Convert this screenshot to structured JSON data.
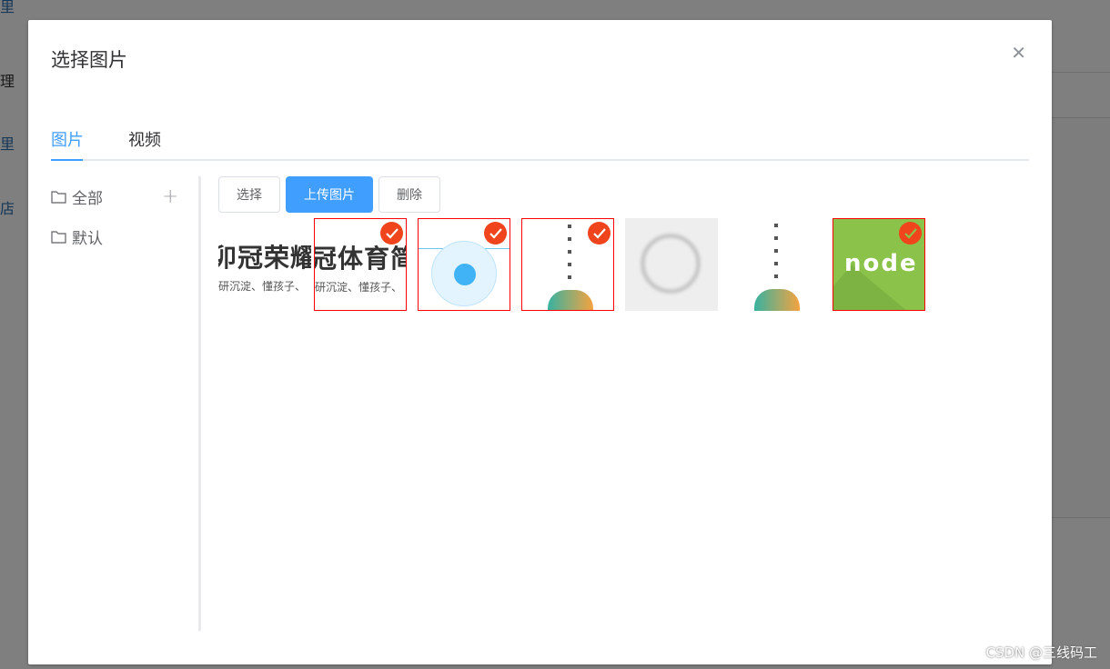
{
  "background": {
    "fragments": [
      "理",
      "理",
      "里",
      "店"
    ]
  },
  "dialog": {
    "title": "选择图片",
    "close_icon": "close-icon",
    "tabs": [
      {
        "label": "图片",
        "active": true
      },
      {
        "label": "视频",
        "active": false
      }
    ],
    "folders": [
      {
        "label": "全部",
        "icon": "folder-icon"
      },
      {
        "label": "默认",
        "icon": "folder-icon"
      }
    ],
    "add_folder_icon": "plus-icon",
    "toolbar": {
      "select": "选择",
      "upload": "上传图片",
      "delete": "删除"
    },
    "thumbnails": [
      {
        "kind": "text-image",
        "selected": false,
        "big": "卯冠荣耀",
        "small": "研沉淀、懂孩子、"
      },
      {
        "kind": "text-image",
        "selected": true,
        "big": "冠体育简",
        "small": "研沉淀、懂孩子、"
      },
      {
        "kind": "app-graphic",
        "selected": true
      },
      {
        "kind": "illustration",
        "selected": true
      },
      {
        "kind": "loading",
        "selected": false
      },
      {
        "kind": "illustration",
        "selected": false
      },
      {
        "kind": "node-logo",
        "selected": true,
        "logo_text": "node"
      }
    ]
  },
  "colors": {
    "primary": "#409eff",
    "selected_border": "#ff0000",
    "check": "#f0441c"
  },
  "watermark": "CSDN @三线码工"
}
